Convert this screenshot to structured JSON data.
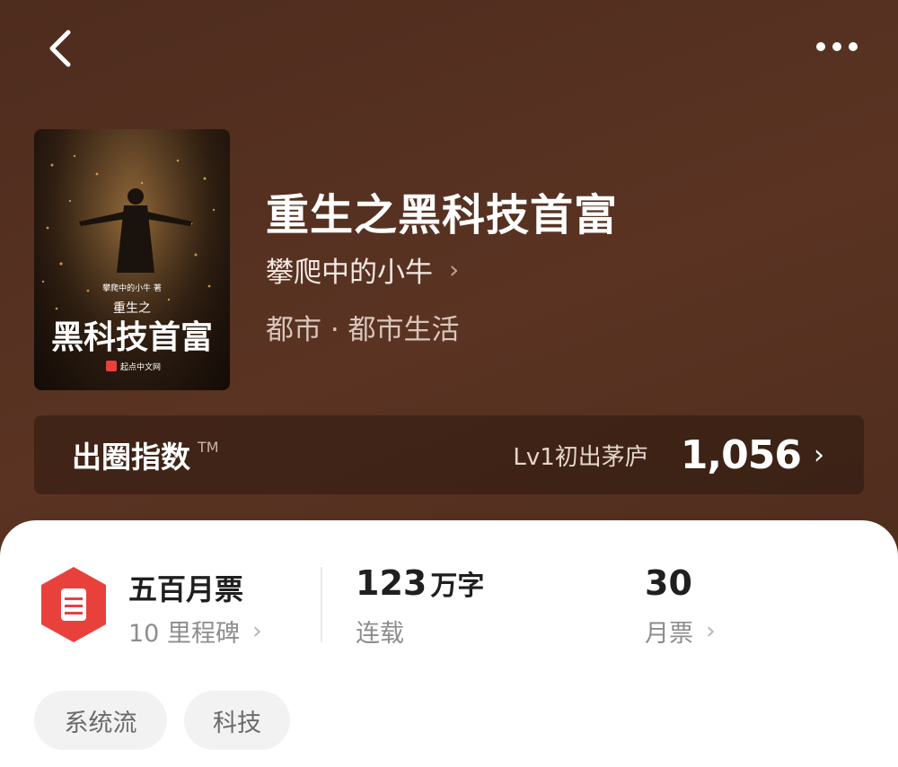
{
  "header": {
    "back_icon": "chevron-left-icon",
    "more_icon": "more-horizontal-icon"
  },
  "book": {
    "title": "重生之黑科技首富",
    "author": "攀爬中的小牛",
    "genre": "都市 · 都市生活",
    "cover": {
      "author_line": "攀爬中的小牛 著",
      "subtitle": "重生之",
      "title": "黑科技首富",
      "publisher": "起点中文网"
    }
  },
  "index_bar": {
    "label": "出圈指数",
    "trademark": "TM",
    "level": "Lv1初出茅庐",
    "value": "1,056"
  },
  "stats": {
    "ticket": {
      "title": "五百月票",
      "subtitle": "10 里程碑",
      "icon": "ticket-icon"
    },
    "words": {
      "value": "123",
      "unit": "万字",
      "status": "连载"
    },
    "monthly": {
      "value": "30",
      "label": "月票"
    }
  },
  "tags": [
    "系统流",
    "科技"
  ],
  "colors": {
    "accent_red": "#e8413b",
    "background_brown": "#553020"
  }
}
